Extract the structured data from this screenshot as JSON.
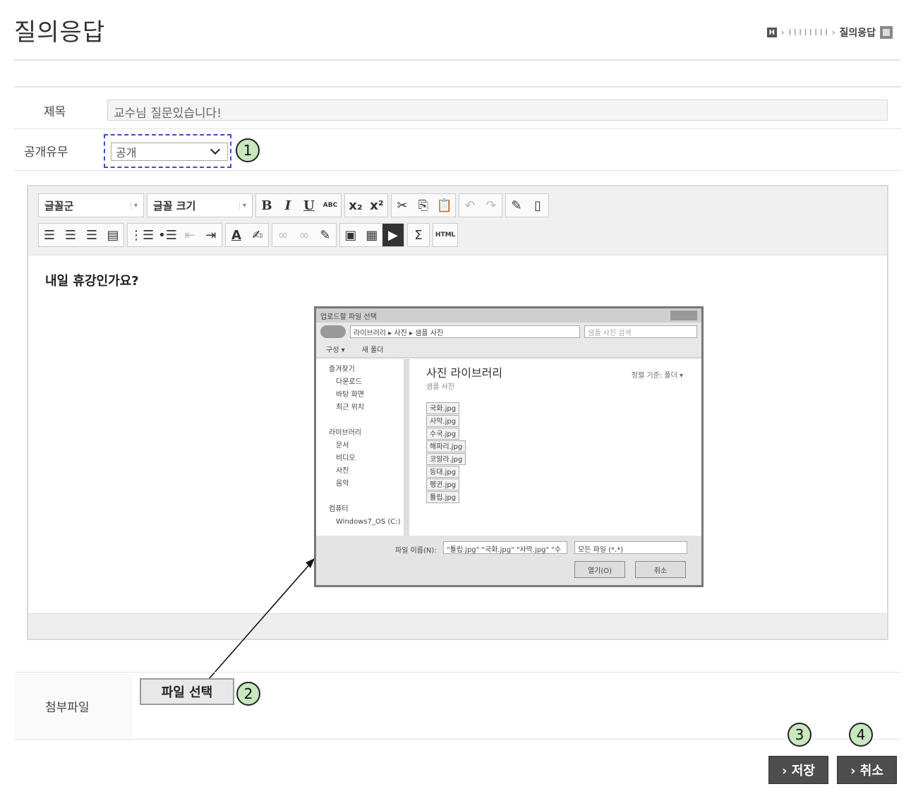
{
  "header": {
    "title": "질의응답",
    "breadcrumb": {
      "home_icon": "home-icon",
      "middle": "I I I I I I I I",
      "current": "질의응답",
      "print_icon": "print-icon"
    }
  },
  "form": {
    "title_label": "제목",
    "title_value": "교수님 질문있습니다!",
    "visibility_label": "공개유무",
    "visibility_value": "공개",
    "attach_label": "첨부파일",
    "file_button": "파일 선택"
  },
  "editor": {
    "font_family": "글꼴군",
    "font_size": "글꼴 크기",
    "body_text": "내일 휴강인가요?",
    "buttons": {
      "bold": "B",
      "italic": "I",
      "underline": "U",
      "strike": "ABC",
      "subscript": "x₂",
      "superscript": "x²",
      "sigma": "Σ",
      "html": "HTML",
      "font_color": "A"
    }
  },
  "dialog": {
    "title": "업로드할 파일 선택",
    "path": "라이브러리 ▸ 사진 ▸ 샘플 사진",
    "search_placeholder": "샘플 사진 검색",
    "cmd_organize": "구성 ▾",
    "cmd_new_folder": "새 폴더",
    "nav_items": [
      {
        "label": "즐겨찾기",
        "sub": false
      },
      {
        "label": "다운로드",
        "sub": true
      },
      {
        "label": "바탕 화면",
        "sub": true
      },
      {
        "label": "최근 위치",
        "sub": true
      },
      {
        "label": "",
        "sub": false
      },
      {
        "label": "라이브러리",
        "sub": false
      },
      {
        "label": "문서",
        "sub": true
      },
      {
        "label": "비디오",
        "sub": true
      },
      {
        "label": "사진",
        "sub": true
      },
      {
        "label": "음악",
        "sub": true
      },
      {
        "label": "",
        "sub": false
      },
      {
        "label": "컴퓨터",
        "sub": false
      },
      {
        "label": "Windows7_OS (C:)",
        "sub": true
      }
    ],
    "library_title": "사진 라이브러리",
    "library_sub": "샘플 사진",
    "sort_label": "정렬 기준: 폴더 ▾",
    "files": [
      "국화.jpg",
      "사막.jpg",
      "수국.jpg",
      "해파리.jpg",
      "코알라.jpg",
      "등대.jpg",
      "펭귄.jpg",
      "튤립.jpg"
    ],
    "filename_label": "파일 이름(N):",
    "filename_value": "\"튤립.jpg\" \"국화.jpg\" \"사막.jpg\" \"수",
    "filetype_value": "모든 파일 (*.*)",
    "open_button": "열기(O)",
    "cancel_button": "취소"
  },
  "markers": [
    "1",
    "2",
    "3",
    "4"
  ],
  "actions": {
    "save": "› 저장",
    "cancel": "› 취소"
  },
  "colors": {
    "marker_fill": "#c8e8c0",
    "select_highlight": "#3b4fc8",
    "action_button": "#4d4d4d"
  }
}
